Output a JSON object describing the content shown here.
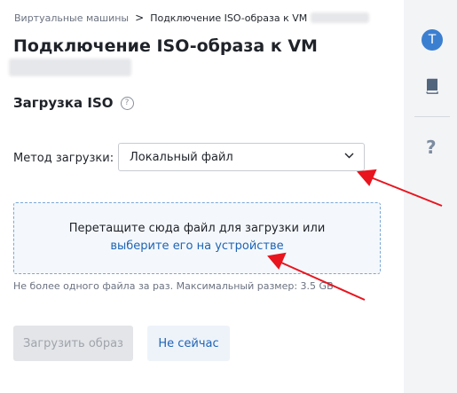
{
  "breadcrumb": {
    "parent": "Виртуальные машины",
    "separator": ">",
    "current": "Подключение ISO-образа к VM"
  },
  "title": "Подключение ISO-образа к VM",
  "section": {
    "title": "Загрузка ISO",
    "help": "?"
  },
  "method": {
    "label": "Метод загрузки:",
    "selected": "Локальный файл"
  },
  "dropzone": {
    "line1": "Перетащите сюда файл для загрузки или",
    "link": "выберите его на устройстве"
  },
  "hint": "Не более одного файла за раз. Максимальный размер: 3.5 GB",
  "buttons": {
    "upload": "Загрузить образ",
    "cancel": "Не сейчас"
  },
  "rail": {
    "avatar_letter": "T",
    "help": "?"
  },
  "colors": {
    "accent": "#1e64b4",
    "annotation_arrow": "#e8141e",
    "avatar": "#3b7fd0"
  },
  "icons": [
    "chevron-down-icon",
    "book-icon",
    "question-icon"
  ]
}
